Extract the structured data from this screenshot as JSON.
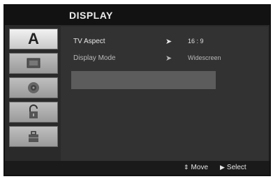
{
  "menu": {
    "title": "DISPLAY"
  },
  "tabs": [
    {
      "name": "language-tab",
      "glyph": "A",
      "active": true
    },
    {
      "name": "display-tab",
      "icon": "tv-screen-icon",
      "active": false
    },
    {
      "name": "audio-tab",
      "icon": "speaker-icon",
      "active": false
    },
    {
      "name": "lock-tab",
      "icon": "padlock-open-icon",
      "active": false
    },
    {
      "name": "others-tab",
      "icon": "briefcase-icon",
      "active": false
    }
  ],
  "settings": [
    {
      "label": "TV Aspect",
      "arrow": "➤",
      "value": "16 : 9"
    },
    {
      "label": "Display Mode",
      "arrow": "➤",
      "value": "Widescreen"
    }
  ],
  "footer": {
    "move_icon": "⇕",
    "move_label": "Move",
    "select_icon": "▶",
    "select_label": "Select"
  },
  "colors": {
    "background": "#2a2a2a",
    "highlight": "#5c5c5c",
    "tab": "#b5b5b5"
  }
}
